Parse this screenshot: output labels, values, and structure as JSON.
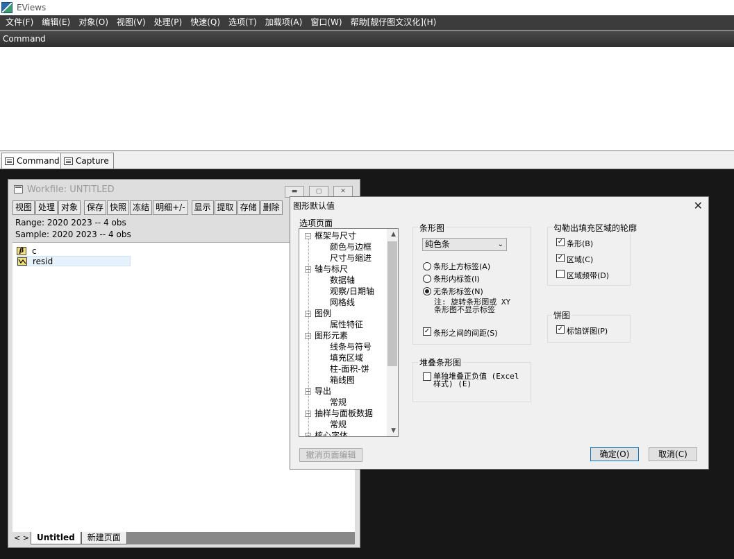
{
  "app": {
    "title": "EViews"
  },
  "menu": [
    "文件(F)",
    "编辑(E)",
    "对象(O)",
    "视图(V)",
    "处理(P)",
    "快速(Q)",
    "选项(T)",
    "加载项(A)",
    "窗口(W)",
    "帮助[靓仔图文汉化](H)"
  ],
  "command": {
    "header": "Command",
    "tabs": [
      "Command",
      "Capture"
    ]
  },
  "workfile": {
    "title": "Workfile: UNTITLED",
    "toolbar": [
      "视图",
      "处理",
      "对象",
      "保存",
      "快照",
      "冻结",
      "明细+/-",
      "显示",
      "提取",
      "存储",
      "删除"
    ],
    "range": "Range:  2020 2023   --   4 obs",
    "sample": "Sample: 2020 2023   --   4 obs",
    "objects": [
      {
        "name": "c",
        "icon": "β"
      },
      {
        "name": "resid",
        "icon": "resid-icon"
      }
    ],
    "nav": "< >",
    "tabs": [
      "Untitled",
      "新建页面"
    ]
  },
  "dialog": {
    "title": "图形默认值",
    "options_label": "选项页面",
    "tree": [
      {
        "label": "框架与尺寸",
        "level": 0
      },
      {
        "label": "颜色与边框",
        "level": 1
      },
      {
        "label": "尺寸与缩进",
        "level": 1
      },
      {
        "label": "轴与标尺",
        "level": 0
      },
      {
        "label": "数据轴",
        "level": 1
      },
      {
        "label": "观察/日期轴",
        "level": 1
      },
      {
        "label": "网格线",
        "level": 1
      },
      {
        "label": "图例",
        "level": 0
      },
      {
        "label": "属性特征",
        "level": 1
      },
      {
        "label": "图形元素",
        "level": 0
      },
      {
        "label": "线条与符号",
        "level": 1
      },
      {
        "label": "填充区域",
        "level": 1
      },
      {
        "label": "柱-面积-饼",
        "level": 1
      },
      {
        "label": "箱线图",
        "level": 1
      },
      {
        "label": "导出",
        "level": 0
      },
      {
        "label": "常规",
        "level": 1
      },
      {
        "label": "抽样与面板数据",
        "level": 0
      },
      {
        "label": "常规",
        "level": 1
      },
      {
        "label": "核心字体",
        "level": 0
      }
    ],
    "bar_group": {
      "label": "条形图",
      "select_value": "纯色条",
      "radios": [
        "条形上方标签(A)",
        "条形内标签(I)",
        "无条形标签(N)"
      ],
      "selected_radio": 2,
      "note_line1": "注: 旋转条形图或 XY",
      "note_line2": "条形图不显示标签",
      "gap_checkbox": "条形之间的间距(S)"
    },
    "stack_group": {
      "label": "堆叠条形图",
      "checkbox_line1": "单独堆叠正负值 (Excel",
      "checkbox_line2": "样式) (E)"
    },
    "outline_group": {
      "label": "勾勒出填充区域的轮廓",
      "checkboxes": [
        "条形(B)",
        "区域(C)",
        "区域频带(D)"
      ],
      "checked": [
        true,
        true,
        false
      ]
    },
    "pie_group": {
      "label": "饼图",
      "checkbox": "标馅饼图(P)"
    },
    "buttons": {
      "undo": "撤消页面编辑",
      "ok": "确定(O)",
      "cancel": "取消(C)"
    }
  }
}
